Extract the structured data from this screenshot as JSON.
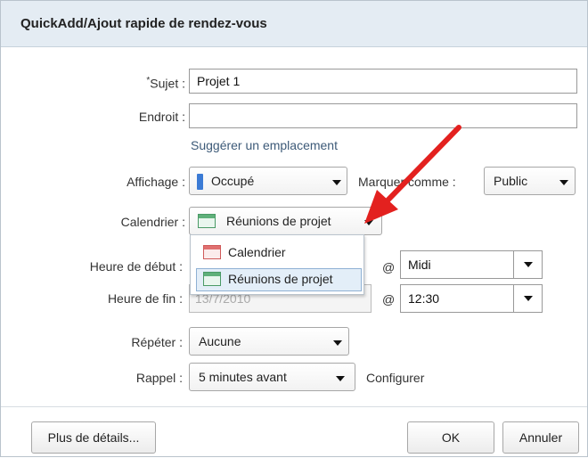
{
  "dialog": {
    "title": "QuickAdd/Ajout rapide de rendez-vous"
  },
  "subject": {
    "required_mark": "*",
    "label": "Sujet :",
    "value": "Projet 1"
  },
  "location": {
    "label": "Endroit :",
    "value": "",
    "suggest_link": "Suggérer un emplacement"
  },
  "show_as": {
    "label": "Affichage :",
    "value": "Occupé",
    "color": "#3b7bd5"
  },
  "mark_as": {
    "label": "Marquer comme :",
    "value": "Public"
  },
  "calendar": {
    "label": "Calendrier :",
    "value": "Réunions de projet",
    "options": [
      {
        "label": "Calendrier",
        "icon": "calendar-red-icon"
      },
      {
        "label": "Réunions de projet",
        "icon": "calendar-green-icon",
        "selected": true
      }
    ]
  },
  "start": {
    "label": "Heure de début :",
    "at": "@",
    "time": "Midi"
  },
  "end": {
    "label": "Heure de fin :",
    "date": "13/7/2010",
    "at": "@",
    "time": "12:30"
  },
  "repeat": {
    "label": "Répéter :",
    "value": "Aucune"
  },
  "reminder": {
    "label": "Rappel :",
    "value": "5 minutes avant",
    "configure_link": "Configurer"
  },
  "buttons": {
    "more_details": "Plus de détails...",
    "ok": "OK",
    "cancel": "Annuler"
  },
  "annotation": {
    "arrow_color": "#e3211f"
  }
}
